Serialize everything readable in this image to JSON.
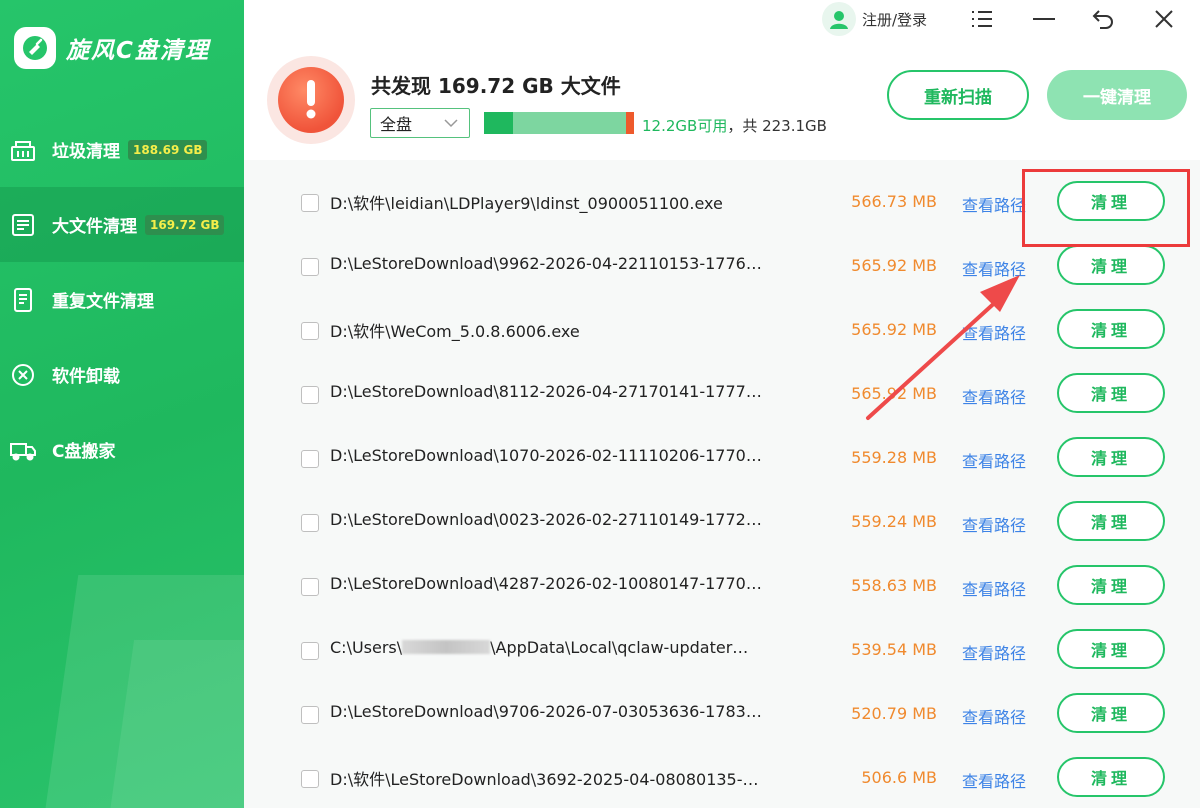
{
  "app": {
    "title": "旋风C盘清理",
    "logo_icon": "broom-logo-icon"
  },
  "sidebar": {
    "items": [
      {
        "label": "垃圾清理",
        "badge": "188.69 GB",
        "icon": "broom-icon",
        "active": false
      },
      {
        "label": "大文件清理",
        "badge": "169.72 GB",
        "icon": "file-icon",
        "active": true
      },
      {
        "label": "重复文件清理",
        "badge": "",
        "icon": "duplicate-file-icon",
        "active": false
      },
      {
        "label": "软件卸载",
        "badge": "",
        "icon": "uninstall-icon",
        "active": false
      },
      {
        "label": "C盘搬家",
        "badge": "",
        "icon": "moving-truck-icon",
        "active": false
      }
    ]
  },
  "topbar": {
    "login_label": "注册/登录",
    "menu_icon": "menu-icon",
    "minimize_icon": "minimize-icon",
    "restore_icon": "restore-icon",
    "close_icon": "close-icon"
  },
  "summary": {
    "title": "共发现 169.72 GB 大文件",
    "scope_value": "全盘",
    "disk_available": "12.2GB可用",
    "disk_total": "，共 223.1GB",
    "disk_used_fraction": 0.945,
    "rescan_label": "重新扫描",
    "oneclick_label": "一键清理"
  },
  "list": {
    "view_label": "查看路径",
    "clean_label": "清理",
    "rows": [
      {
        "path": "D:\\软件\\leidian\\LDPlayer9\\ldinst_0900051100.exe",
        "size": "566.73 MB"
      },
      {
        "path": "D:\\LeStoreDownload\\9962-2026-04-22110153-1776…",
        "size": "565.92 MB"
      },
      {
        "path": "D:\\软件\\WeCom_5.0.8.6006.exe",
        "size": "565.92 MB"
      },
      {
        "path": "D:\\LeStoreDownload\\8112-2026-04-27170141-1777…",
        "size": "565.92 MB"
      },
      {
        "path": "D:\\LeStoreDownload\\1070-2026-02-11110206-1770…",
        "size": "559.28 MB"
      },
      {
        "path": "D:\\LeStoreDownload\\0023-2026-02-27110149-1772…",
        "size": "559.24 MB"
      },
      {
        "path": "D:\\LeStoreDownload\\4287-2026-02-10080147-1770…",
        "size": "558.63 MB"
      },
      {
        "path_prefix": "C:\\Users\\",
        "path_suffix": "\\AppData\\Local\\qclaw-updater…",
        "size": "539.54 MB"
      },
      {
        "path": "D:\\LeStoreDownload\\9706-2026-07-03053636-1783…",
        "size": "520.79 MB"
      },
      {
        "path": "D:\\软件\\LeStoreDownload\\3692-2025-04-08080135-…",
        "size": "506.6 MB"
      }
    ]
  },
  "colors": {
    "brand_green": "#1fb85e",
    "size_orange": "#f08a2e",
    "link_blue": "#3d83e6",
    "annotation_red": "#ec3b3b"
  }
}
